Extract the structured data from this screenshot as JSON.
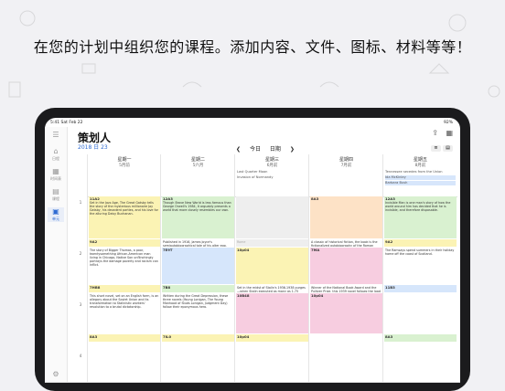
{
  "headline": "在您的计划中组织您的课程。添加内容、文件、图标、材料等等！",
  "statusbar": {
    "time": "5:41",
    "date": "Sat Feb 22",
    "battery": "92%"
  },
  "sidebar": {
    "items": [
      {
        "label": "日程",
        "icon": "home-icon"
      },
      {
        "label": "时间表",
        "icon": "schedule-icon"
      },
      {
        "label": "课程",
        "icon": "courses-icon"
      },
      {
        "label": "单元",
        "icon": "units-icon"
      }
    ],
    "active_index": 3
  },
  "header": {
    "title": "策划人",
    "date": "2018 日 23",
    "today": "今日",
    "day_label": "日期"
  },
  "days": [
    {
      "name": "星期一",
      "date": "5月前"
    },
    {
      "name": "星期二",
      "date": "5六月"
    },
    {
      "name": "星期三",
      "date": "6月前"
    },
    {
      "name": "星期四",
      "date": "7月前"
    },
    {
      "name": "星期五",
      "date": "8月前"
    }
  ],
  "allday": {
    "wed": [
      "Last Quarter Moon",
      "Invasion of Normandy"
    ],
    "fri": [
      "Tennessee secedes from the Union",
      "Ida McKinley",
      "Barbara Bush"
    ]
  },
  "periods": [
    "1",
    "2",
    "3",
    "4"
  ],
  "events": {
    "mon": [
      {
        "time": "11A2",
        "text": "Set in the Jazz Age, The Great Gatsby tells the story of the mysterious millionaire Jay Gatsby, his decadent parties, and his love for the alluring Daisy Buchanan.",
        "color": "ev-y"
      },
      {
        "time": "9A2",
        "text": "",
        "color": "ev-y"
      },
      {
        "time": "",
        "text": "The story of Bigger Thomas, a poor, twentysomething African-American man living in Chicago, Native Son unflinchingly portrays the damage poverty and racism can inflict.",
        "color": "ev-t"
      },
      {
        "time": "7HB8",
        "text": "",
        "color": "ev-y"
      },
      {
        "time": "",
        "text": "This short novel, set on an English farm, is an allegory about the Soviet Union and its transformation to Stalinistic workers' revolution to a brutal dictatorship.",
        "color": "ev-t"
      },
      {
        "time": "8A3",
        "text": "",
        "color": "ev-y"
      }
    ],
    "tue": [
      {
        "time": "12A3",
        "text": "Though Brave New World is less famous than George Orwell's 1984, it arguably presents a world that more closely resembles our own.",
        "color": "ev-g"
      },
      {
        "time": "",
        "text": "Published in 1916, James Joyce's semiautobiographical tale of his alter ego, Stephen Dedalus, is a coming-of-age story.",
        "color": "ev-t"
      },
      {
        "time": "7E9T",
        "text": "",
        "color": "ev-b"
      },
      {
        "time": "7B8",
        "text": "",
        "color": "ev-g"
      },
      {
        "time": "",
        "text": "Written during the Great Depression, these three novels (Young Lonigan, The Young Manhood of Studs Lonigan, Judgment Day) follow their eponymous hero.",
        "color": "ev-t"
      },
      {
        "time": "7IL0",
        "text": "",
        "color": "ev-y"
      }
    ],
    "wed": [
      {
        "time": "",
        "text": "",
        "color": "ev-gray"
      },
      {
        "time": "",
        "text": "Rome",
        "color": "ev-gray"
      },
      {
        "time": "10p04",
        "text": "",
        "color": "ev-y"
      },
      {
        "time": "",
        "text": "Set in the midst of Stalin's 1936-1938 purges—when Stalin executed as many as 1.75 million people.",
        "color": "ev-t"
      },
      {
        "time": "10B48",
        "text": "",
        "color": "ev-p"
      },
      {
        "time": "10p04",
        "text": "",
        "color": "ev-y"
      }
    ],
    "thu": [
      {
        "time": "8A3",
        "text": "",
        "color": "ev-o"
      },
      {
        "time": "",
        "text": "A classic of historical fiction, the book is the fictionalized autobiography of the Roman Emperor Claudius.",
        "color": "ev-t"
      },
      {
        "time": "7MA",
        "text": "",
        "color": "ev-p"
      },
      {
        "time": "",
        "text": "Winner of the National Book Award and the Pulitzer Prize, this 1939 novel follows the Joad family as they leave the Oklahoma Dust Bowl.",
        "color": "ev-t"
      },
      {
        "time": "10p04",
        "text": "",
        "color": "ev-p"
      },
      {
        "time": "",
        "text": "",
        "color": "ev-t"
      }
    ],
    "fri": [
      {
        "time": "12A3",
        "text": "Invisible Man is one man's story of how the world around him has decided that he is invisible, and therefore disposable.",
        "color": "ev-g"
      },
      {
        "time": "9A2",
        "text": "",
        "color": "ev-y"
      },
      {
        "time": "",
        "text": "The Ramsays spend summers in their holiday home off the coast of Scotland.",
        "color": "ev-t"
      },
      {
        "time": "11B3",
        "text": "",
        "color": "ev-b"
      },
      {
        "time": "",
        "text": "",
        "color": "ev-t"
      },
      {
        "time": "8A3",
        "text": "",
        "color": "ev-g"
      }
    ]
  }
}
